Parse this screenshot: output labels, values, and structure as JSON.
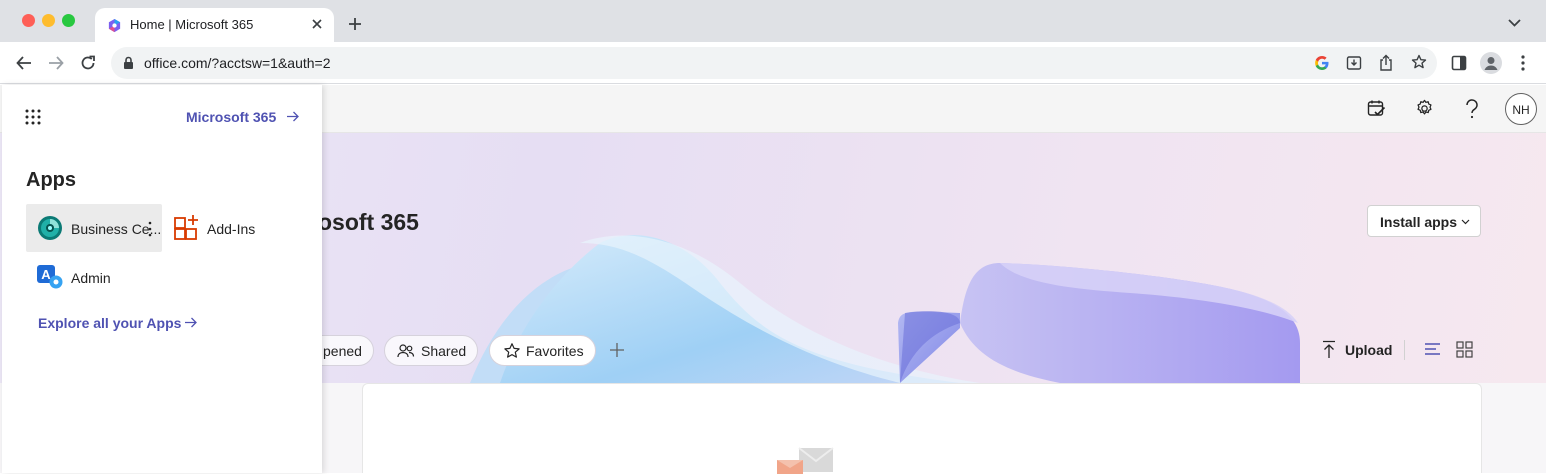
{
  "browser": {
    "tab_title": "Home | Microsoft 365",
    "url": "office.com/?acctsw=1&auth=2"
  },
  "app": {
    "user_initials": "NH",
    "install_apps_label": "Install apps",
    "hero_title_partial": "osoft 365",
    "filters": {
      "opened_partial": "pened",
      "shared": "Shared",
      "favorites": "Favorites"
    },
    "upload_label": "Upload"
  },
  "launcher": {
    "m365_link": "Microsoft 365",
    "apps_heading": "Apps",
    "apps": [
      {
        "name": "Business Ce..."
      },
      {
        "name": "Add-Ins"
      },
      {
        "name": "Admin"
      }
    ],
    "explore_link": "Explore all your Apps"
  },
  "colors": {
    "link_blue": "#4f52b2",
    "chrome_bg": "#dfe1e5",
    "addins_orange": "#d83b01"
  }
}
